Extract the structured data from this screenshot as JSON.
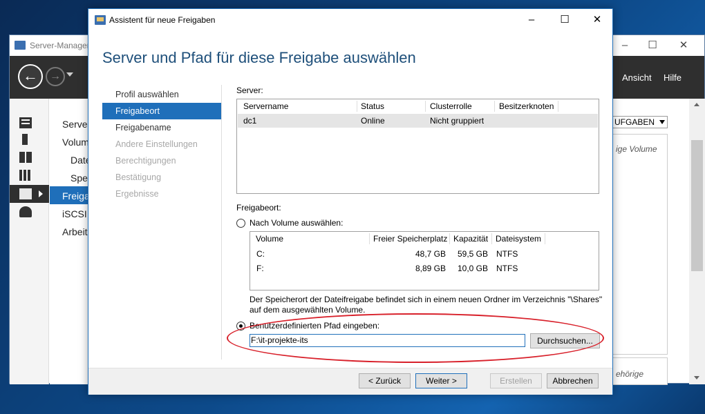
{
  "server_manager": {
    "title": "Server-Manager",
    "menu": [
      "Ansicht",
      "Hilfe"
    ],
    "tree": [
      "Server",
      "Volum",
      "Date",
      "Spei",
      "Freiga",
      "iSCSI",
      "Arbeit"
    ],
    "aufgaben_label": "UFGABEN",
    "panel_text_1": "ige Volume",
    "panel_text_2": "ehörige",
    "window_controls": [
      "–",
      "☐",
      "✕"
    ]
  },
  "wizard": {
    "title": "Assistent für neue Freigaben",
    "window_controls": [
      "–",
      "☐",
      "✕"
    ],
    "heading": "Server und Pfad für diese Freigabe auswählen",
    "steps": [
      {
        "label": "Profil auswählen",
        "state": "normal"
      },
      {
        "label": "Freigabeort",
        "state": "active"
      },
      {
        "label": "Freigabename",
        "state": "normal"
      },
      {
        "label": "Andere Einstellungen",
        "state": "disabled"
      },
      {
        "label": "Berechtigungen",
        "state": "disabled"
      },
      {
        "label": "Bestätigung",
        "state": "disabled"
      },
      {
        "label": "Ergebnisse",
        "state": "disabled"
      }
    ],
    "server_label": "Server:",
    "server_table": {
      "columns": [
        "Servername",
        "Status",
        "Clusterrolle",
        "Besitzerknoten"
      ],
      "rows": [
        [
          "dc1",
          "Online",
          "Nicht gruppiert",
          ""
        ]
      ]
    },
    "location_label": "Freigabeort:",
    "radio_volume_label": "Nach Volume auswählen:",
    "volume_table": {
      "columns": [
        "Volume",
        "Freier Speicherplatz",
        "Kapazität",
        "Dateisystem"
      ],
      "rows": [
        [
          "C:",
          "48,7 GB",
          "59,5 GB",
          "NTFS"
        ],
        [
          "F:",
          "8,89 GB",
          "10,0 GB",
          "NTFS"
        ]
      ]
    },
    "info_line_1": "Der Speicherort der Dateifreigabe befindet sich in einem neuen Ordner im Verzeichnis \"\\Shares\"",
    "info_line_2": "auf dem ausgewählten Volume.",
    "radio_custom_label": "Benutzerdefinierten Pfad eingeben:",
    "path_value": "F:\\it-projekte-its",
    "browse_label": "Durchsuchen...",
    "buttons": {
      "back": "< Zurück",
      "next": "Weiter >",
      "create": "Erstellen",
      "cancel": "Abbrechen"
    }
  },
  "colors": {
    "accent": "#1f6fba",
    "heading": "#1e4f7a",
    "annotation": "#d8202a"
  }
}
